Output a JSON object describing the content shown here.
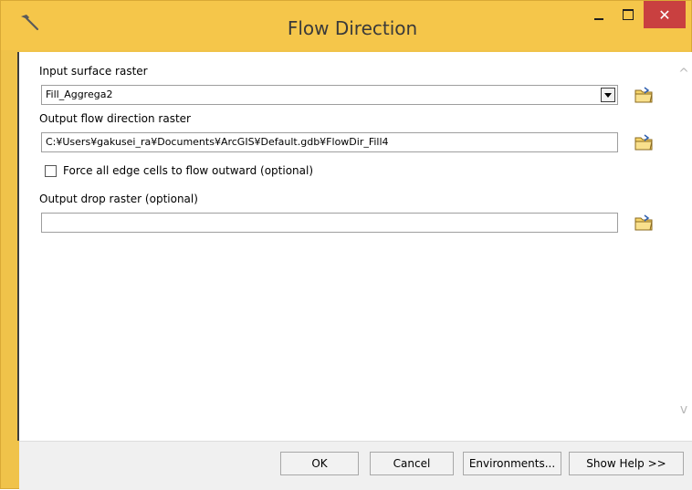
{
  "window": {
    "title": "Flow Direction",
    "accent_color": "#f5c64a",
    "close_color": "#c94040"
  },
  "titlebar": {
    "app_icon": "hammer-icon",
    "min_icon": "minimize-icon",
    "max_icon": "maximize-icon",
    "close_label": "✕"
  },
  "form": {
    "input_surface": {
      "label": "Input surface raster",
      "value": "Fill_Aggrega2",
      "icon": "folder-open-icon"
    },
    "output_flow": {
      "label": "Output flow direction raster",
      "value": "C:¥Users¥gakusei_ra¥Documents¥ArcGIS¥Default.gdb¥FlowDir_Fill4",
      "icon": "folder-open-icon"
    },
    "force_edge": {
      "label": "Force all edge cells to flow outward (optional)",
      "checked": false
    },
    "output_drop": {
      "label": "Output drop raster (optional)",
      "value": "",
      "icon": "folder-open-icon"
    }
  },
  "footer": {
    "ok_label": "OK",
    "cancel_label": "Cancel",
    "environments_label": "Environments...",
    "show_help_label": "Show Help >>"
  },
  "scroll": {
    "up": "^",
    "down": "v"
  }
}
